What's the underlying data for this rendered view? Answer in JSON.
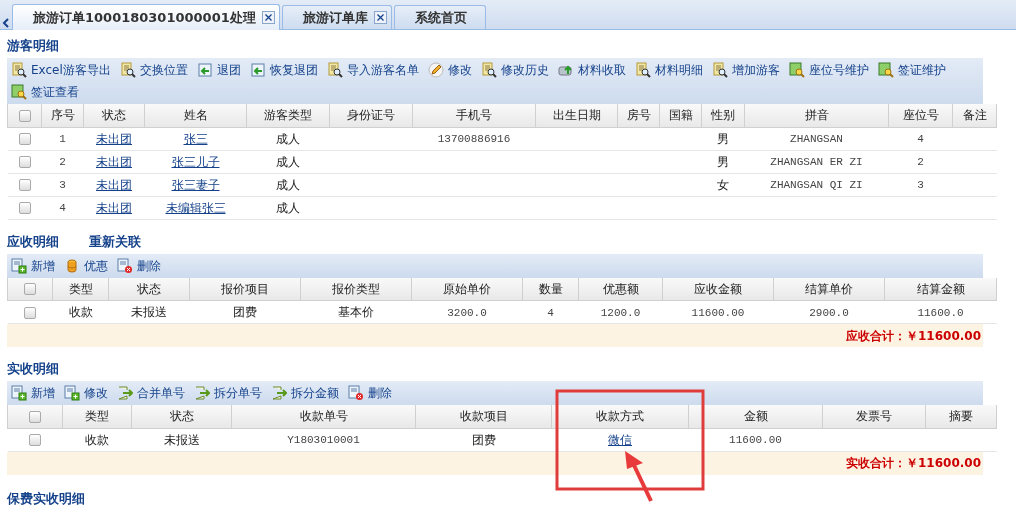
{
  "tabs": [
    {
      "label": "旅游订单1000180301000001处理",
      "selected": true,
      "closable": true
    },
    {
      "label": "旅游订单库",
      "selected": false,
      "closable": true
    },
    {
      "label": "系统首页",
      "selected": false,
      "closable": false
    }
  ],
  "tourists": {
    "title": "游客明细",
    "toolbar": [
      "Excel游客导出",
      "交换位置",
      "退团",
      "恢复退团",
      "导入游客名单",
      "修改",
      "修改历史",
      "材料收取",
      "材料明细",
      "增加游客",
      "座位号维护",
      "签证维护",
      "签证查看"
    ],
    "all_checked": false,
    "columns": [
      "序号",
      "状态",
      "姓名",
      "游客类型",
      "身份证号",
      "手机号",
      "出生日期",
      "房号",
      "国籍",
      "性别",
      "拼音",
      "座位号",
      "备注"
    ],
    "rows": [
      {
        "checked": false,
        "cells": [
          "1",
          "未出团",
          "张三",
          "成人",
          null,
          "13700886916",
          null,
          null,
          null,
          "男",
          "ZHANGSAN",
          "4",
          null
        ]
      },
      {
        "checked": false,
        "cells": [
          "2",
          "未出团",
          "张三儿子",
          "成人",
          null,
          null,
          null,
          null,
          null,
          "男",
          "ZHANGSAN ER ZI",
          "2",
          null
        ]
      },
      {
        "checked": false,
        "cells": [
          "3",
          "未出团",
          "张三妻子",
          "成人",
          null,
          null,
          null,
          null,
          null,
          "女",
          "ZHANGSAN QI ZI",
          "3",
          null
        ]
      },
      {
        "checked": false,
        "cells": [
          "4",
          "未出团",
          "未编辑张三",
          "成人",
          null,
          null,
          null,
          null,
          null,
          null,
          null,
          null,
          null
        ]
      }
    ]
  },
  "receivable": {
    "title": "应收明细",
    "relink": "重新关联",
    "toolbar": [
      "新增",
      "优惠",
      "删除"
    ],
    "all_checked": false,
    "columns": [
      "类型",
      "状态",
      "报价项目",
      "报价类型",
      "原始单价",
      "数量",
      "优惠额",
      "应收金额",
      "结算单价",
      "结算金额"
    ],
    "rows": [
      {
        "checked": false,
        "cells": [
          "收款",
          "未报送",
          "团费",
          "基本价",
          "3200.0",
          "4",
          "1200.0",
          "11600.00",
          "2900.0",
          "11600.0"
        ]
      }
    ],
    "total": "应收合计：￥11600.00"
  },
  "received": {
    "title": "实收明细",
    "toolbar": [
      "新增",
      "修改",
      "合并单号",
      "拆分单号",
      "拆分金额",
      "删除"
    ],
    "all_checked": false,
    "columns": [
      "类型",
      "状态",
      "收款单号",
      "收款项目",
      "收款方式",
      "金额",
      "发票号",
      "摘要"
    ],
    "rows": [
      {
        "checked": false,
        "cells": [
          "收款",
          "未报送",
          "Y1803010001",
          "团费",
          "微信",
          "11600.00",
          null,
          null
        ]
      }
    ],
    "total": "实收合计：￥11600.00"
  },
  "insurance": {
    "title": "保费实收明细"
  }
}
